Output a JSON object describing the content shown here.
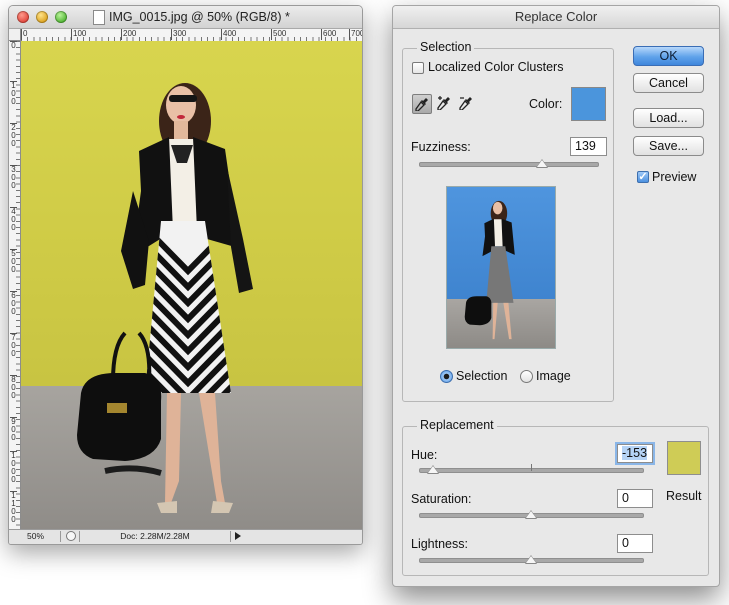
{
  "document": {
    "title": "IMG_0015.jpg @ 50% (RGB/8) *",
    "ruler_h_labels": [
      "0",
      "100",
      "200",
      "300",
      "400",
      "500",
      "600",
      "700"
    ],
    "ruler_v_labels": [
      "0",
      "100",
      "200",
      "300",
      "400",
      "500",
      "600",
      "700",
      "800",
      "900",
      "1000",
      "1100"
    ],
    "status_zoom": "50%",
    "status_doc": "Doc: 2.28M/2.28M"
  },
  "dialog": {
    "title": "Replace Color",
    "selection": {
      "group_title": "Selection",
      "localized_label": "Localized Color Clusters",
      "localized_checked": false,
      "color_label": "Color:",
      "color_value": "#4b95dc",
      "fuzziness_label": "Fuzziness:",
      "fuzziness_value": "139",
      "radio_selection_label": "Selection",
      "radio_image_label": "Image",
      "radio_selected": "Selection"
    },
    "replacement": {
      "group_title": "Replacement",
      "hue_label": "Hue:",
      "hue_value": "-153",
      "saturation_label": "Saturation:",
      "saturation_value": "0",
      "lightness_label": "Lightness:",
      "lightness_value": "0",
      "result_label": "Result",
      "result_color": "#cfcc56"
    },
    "buttons": {
      "ok": "OK",
      "cancel": "Cancel",
      "load": "Load...",
      "save": "Save..."
    },
    "preview_label": "Preview",
    "preview_checked": true
  },
  "icons": {
    "eyedropper": "eyedropper-icon",
    "eyedropper_plus": "eyedropper-plus-icon",
    "eyedropper_minus": "eyedropper-minus-icon"
  }
}
